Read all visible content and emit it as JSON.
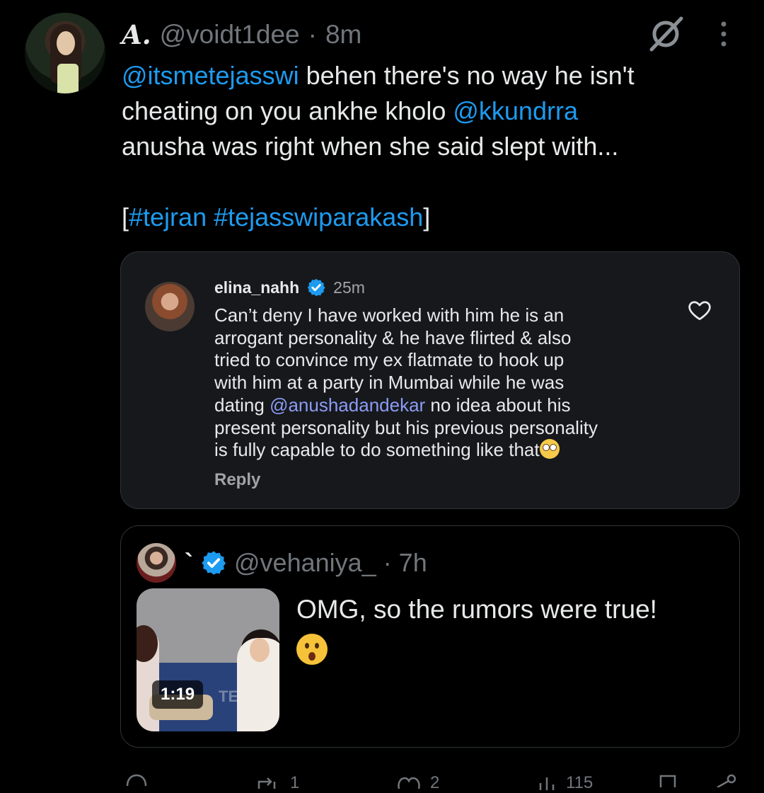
{
  "tweet": {
    "display_name": "A.",
    "handle": "@voidt1dee",
    "separator": "·",
    "time": "8m",
    "icons": {
      "avatar": "profile-avatar",
      "grok": "grok-icon",
      "more": "more-vertical-icon"
    },
    "text": {
      "line1_mention": "@itsmetejasswi",
      "line1_rest": " behen there's no way he isn't",
      "line2_start": "cheating on you ankhe kholo ",
      "line2_mention": "@kkundrra",
      "line3": "anusha was right when she said slept with...",
      "line5_open": "[",
      "line5_hashtag1": "#tejran",
      "line5_space": " ",
      "line5_hashtag2": "#tejasswiparakash",
      "line5_close": "]"
    }
  },
  "quote": {
    "username": "elina_nahh",
    "time": "25m",
    "lines": [
      "Can’t deny I have worked with him he is an",
      "arrogant personality & he have flirted & also",
      "tried to convince my ex flatmate to hook up",
      "with him at a party in Mumbai while he was"
    ],
    "line5_start": "dating ",
    "line5_mention": "@anushadandekar",
    "line5_rest": " no idea about his",
    "line6": "present personality but his previous personality",
    "line7": "is fully capable to do something like that",
    "reply_label": "Reply",
    "icons": {
      "verified": "verified-badge-icon",
      "like": "heart-icon",
      "emoji": "face-with-rolling-eyes"
    }
  },
  "embedded": {
    "name": "`",
    "handle": "@vehaniya_",
    "separator": "·",
    "time": "7h",
    "duration": "1:19",
    "watermark": "TE",
    "text": "OMG, so the rumors were true!",
    "icons": {
      "verified": "verified-badge-icon",
      "emoji": "hushed-face"
    }
  },
  "actions": {
    "retweets": "1",
    "likes": "2",
    "views": "115"
  },
  "colors": {
    "background": "#000000",
    "link": "#1d9bf0",
    "quote_link": "#8c9bf3",
    "verified": "#1d9bf0",
    "muted": "#71767b",
    "card_bg": "#16181c"
  }
}
